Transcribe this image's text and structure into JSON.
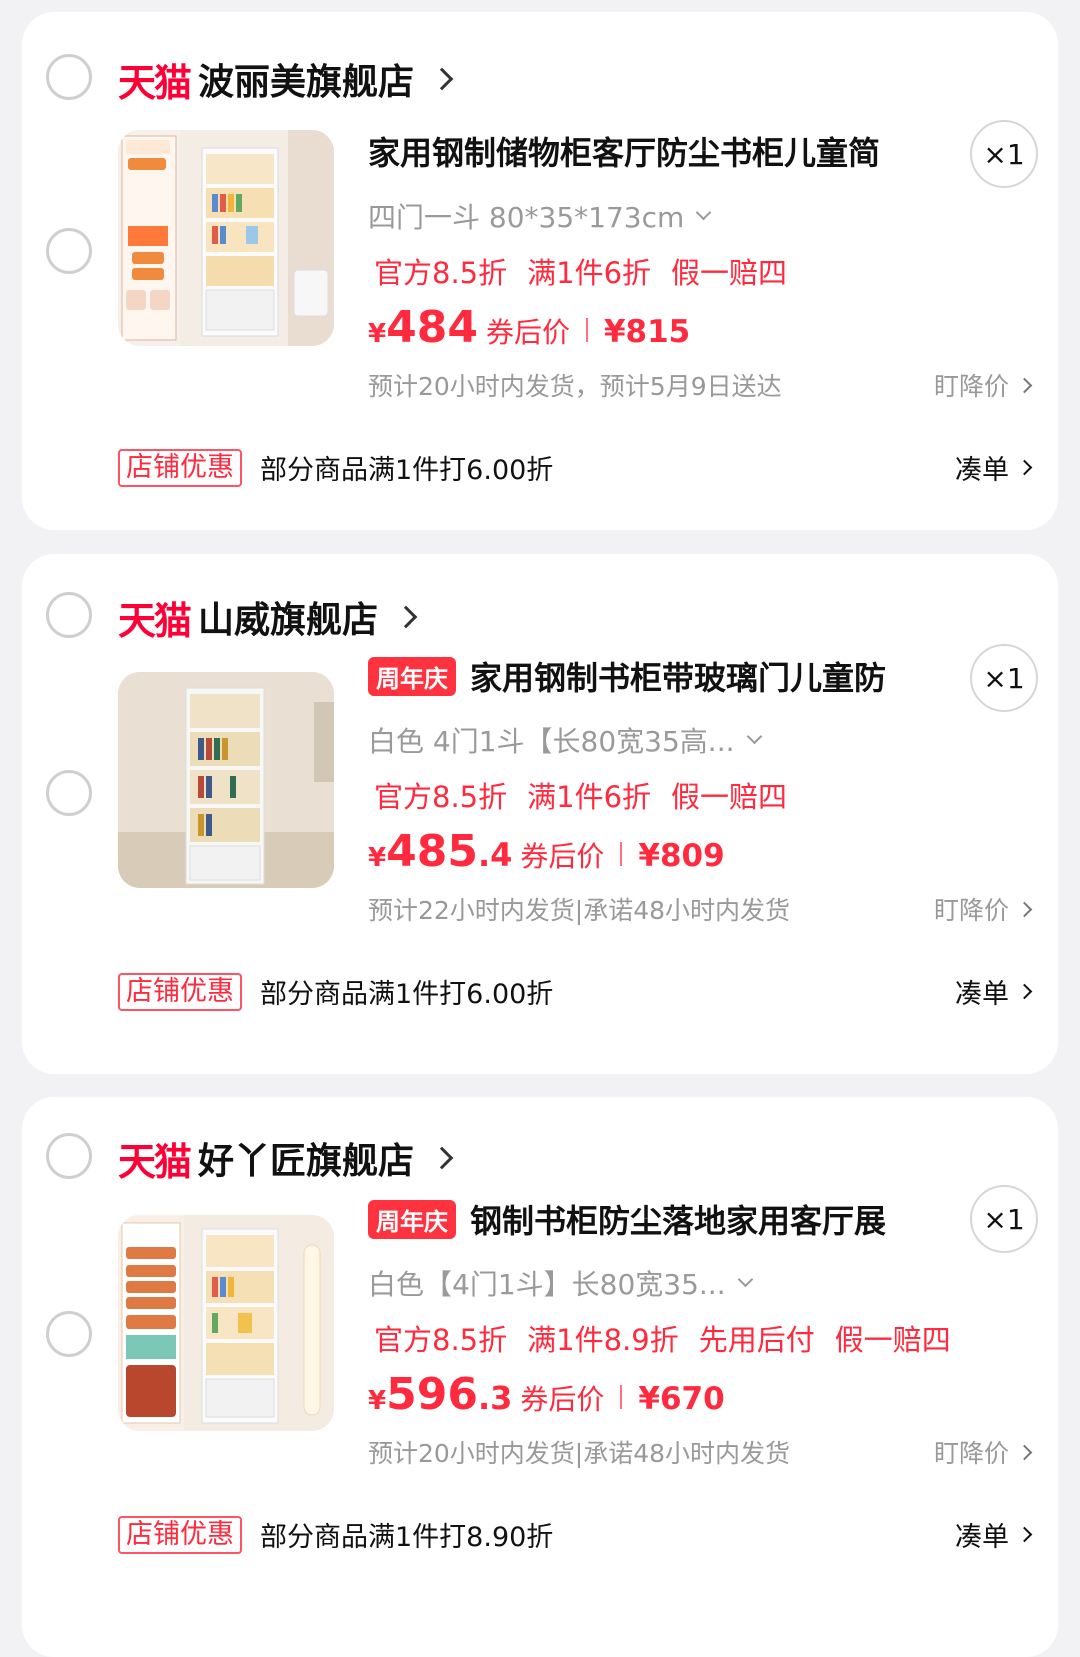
{
  "stores": [
    {
      "logo": "天猫",
      "name": "波丽美旗舰店",
      "product": {
        "badge": "",
        "title": "家用钢制储物柜客厅防尘书柜儿童简",
        "quantity": "×1",
        "spec": "四门一斗 80*35*173cm",
        "tags": [
          "官方8.5折",
          "满1件6折",
          "假一赔四"
        ],
        "price_yen": "¥",
        "price_int": "484",
        "price_dec": "",
        "price_label": "券后价",
        "orig_price": "¥815",
        "shipping": "预计20小时内发货，预计5月9日送达",
        "watch": "盯降价",
        "thumb_text": [
          "四门一斗",
          "云朵白",
          "长: 800 mm",
          "深: 350 mm",
          "高: 1727 mm",
          "上翻门",
          "下抽屉"
        ]
      },
      "promo_tag": "店铺优惠",
      "promo_text": "部分商品满1件打6.00折",
      "promo_action": "凑单"
    },
    {
      "logo": "天猫",
      "name": "山威旗舰店",
      "product": {
        "badge": "周年庆",
        "title": "家用钢制书柜带玻璃门儿童防",
        "quantity": "×1",
        "spec": "白色 4门1斗【长80宽35高...",
        "tags": [
          "官方8.5折",
          "满1件6折",
          "假一赔四"
        ],
        "price_yen": "¥",
        "price_int": "485",
        "price_dec": ".4",
        "price_label": "券后价",
        "orig_price": "¥809",
        "shipping": "预计22小时内发货|承诺48小时内发货",
        "watch": "盯降价",
        "thumb_text": []
      },
      "promo_tag": "店铺优惠",
      "promo_text": "部分商品满1件打6.00折",
      "promo_action": "凑单"
    },
    {
      "logo": "天猫",
      "name": "好丫匠旗舰店",
      "product": {
        "badge": "周年庆",
        "title": "钢制书柜防尘落地家用客厅展",
        "quantity": "×1",
        "spec": "白色【4门1斗】长80宽35...",
        "tags": [
          "官方8.5折",
          "满1件8.9折",
          "先用后付",
          "假一赔四"
        ],
        "price_yen": "¥",
        "price_int": "596",
        "price_dec": ".3",
        "price_label": "券后价",
        "orig_price": "¥670",
        "shipping": "预计20小时内发货|承诺48小时内发货",
        "watch": "盯降价",
        "thumb_text": [
          "4门1抽",
          "上翻下斗",
          "长:80cm",
          "宽:35cm",
          "高:173cm",
          "高清钢化玻璃",
          "破损包赔",
          "防尘柜门",
          "十年质保",
          "送货上门"
        ]
      },
      "promo_tag": "店铺优惠",
      "promo_text": "部分商品满1件打8.90折",
      "promo_action": "凑单"
    }
  ],
  "colors": {
    "brand_red": "#ff0036",
    "price_red": "#ff2a3d",
    "background": "#f2f2f4"
  }
}
